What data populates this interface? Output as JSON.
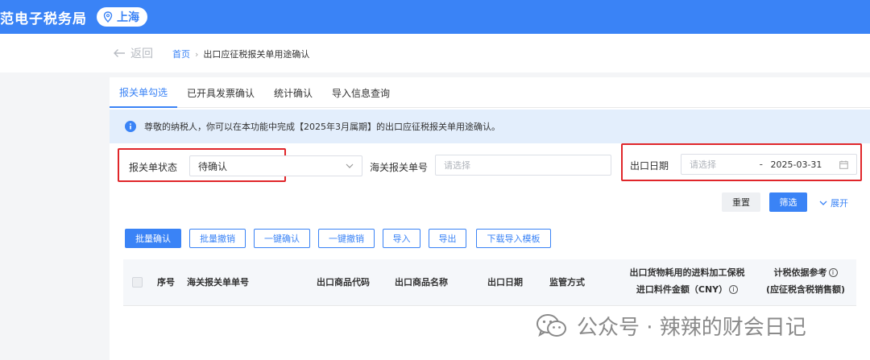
{
  "header": {
    "title": "范电子税务局",
    "region": "上海"
  },
  "nav": {
    "back_label": "返回",
    "breadcrumb_home": "首页",
    "breadcrumb_current": "出口应征税报关单用途确认"
  },
  "tabs": [
    {
      "label": "报关单勾选",
      "active": true
    },
    {
      "label": "已开具发票确认",
      "active": false
    },
    {
      "label": "统计确认",
      "active": false
    },
    {
      "label": "导入信息查询",
      "active": false
    }
  ],
  "notice": {
    "text": "尊敬的纳税人，你可以在本功能中完成【2025年3月属期】的出口应征税报关单用途确认。"
  },
  "filters": {
    "status_label": "报关单状态",
    "status_value": "待确认",
    "customs_no_label": "海关报关单号",
    "customs_no_placeholder": "请选择",
    "export_date_label": "出口日期",
    "export_date_start_placeholder": "请选择",
    "date_separator": "-",
    "export_date_end": "2025-03-31"
  },
  "filter_actions": {
    "reset_label": "重置",
    "filter_label": "筛选",
    "expand_label": "展开"
  },
  "toolbar": {
    "batch_confirm": "批量确认",
    "batch_revoke": "批量撤销",
    "one_click_confirm": "一键确认",
    "one_click_revoke": "一键撤销",
    "import": "导入",
    "export": "导出",
    "download_template": "下载导入模板"
  },
  "table": {
    "columns": {
      "seq": "序号",
      "customs_no": "海关报关单单号",
      "product_code": "出口商品代码",
      "product_name": "出口商品名称",
      "export_date": "出口日期",
      "supervision": "监管方式",
      "material_amount_line1": "出口货物耗用的进料加工保税",
      "material_amount_line2": "进口料件金额（CNY）",
      "tax_basis_line1": "计税依据参考",
      "tax_basis_line2": "(应征税含税销售额)"
    }
  },
  "watermark": {
    "text": "公众号 · 辣辣的财会日记"
  },
  "colors": {
    "brand": "#3a83f6",
    "highlight": "#e0262a",
    "notice_bg": "#e3eefc"
  }
}
